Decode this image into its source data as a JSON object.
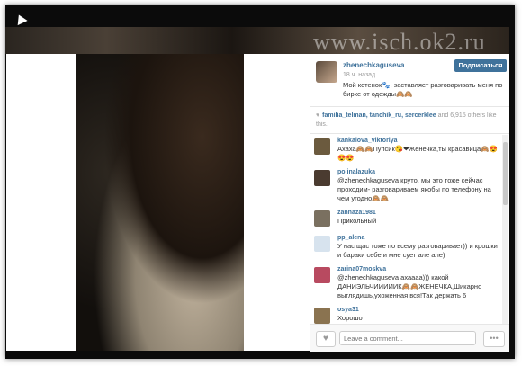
{
  "watermark": "www.isch.ok2.ru",
  "post": {
    "username": "zhenechkaguseva",
    "follow_label": "Подписаться",
    "time": "18 ч. назад",
    "caption": "Мой котенок🐾, заставляет разговаривать меня по бирке от одежды🙈🙈"
  },
  "likes": {
    "names": "familia_telman, tanchik_ru, sercerklee",
    "rest": " and 6,915 others like this."
  },
  "comments": [
    {
      "user": "kankalova_viktoriya",
      "text": "Ахаха🙈🙈Пупсик😘❤Женечка,ты красавица🙈😍😍😍"
    },
    {
      "user": "polinalazuka",
      "text": "@zhenechkaguseva круто, мы это тоже сейчас проходим- разговариваем якобы по телефону на чем угодно🙈🙈"
    },
    {
      "user": "zannaza1981",
      "text": "Прикольный"
    },
    {
      "user": "pp_alena",
      "text": "У нас щас тоже по всему разговаривает)) и крошки и бараки себе и мне сует але але)"
    },
    {
      "user": "zarina07moskva",
      "text": "@zhenechkaguseva ахаааа))) какой ДАНИЭЛЬЧИИИИИК🙈🙈ЖЕНЕЧКА,Шикарно выглядишь,ухоженная вся!Так держать 6"
    },
    {
      "user": "osya31",
      "text": "Хорошо"
    }
  ],
  "footer": {
    "comment_placeholder": "Leave a comment...",
    "more_label": "•••",
    "like_icon": "♥"
  }
}
